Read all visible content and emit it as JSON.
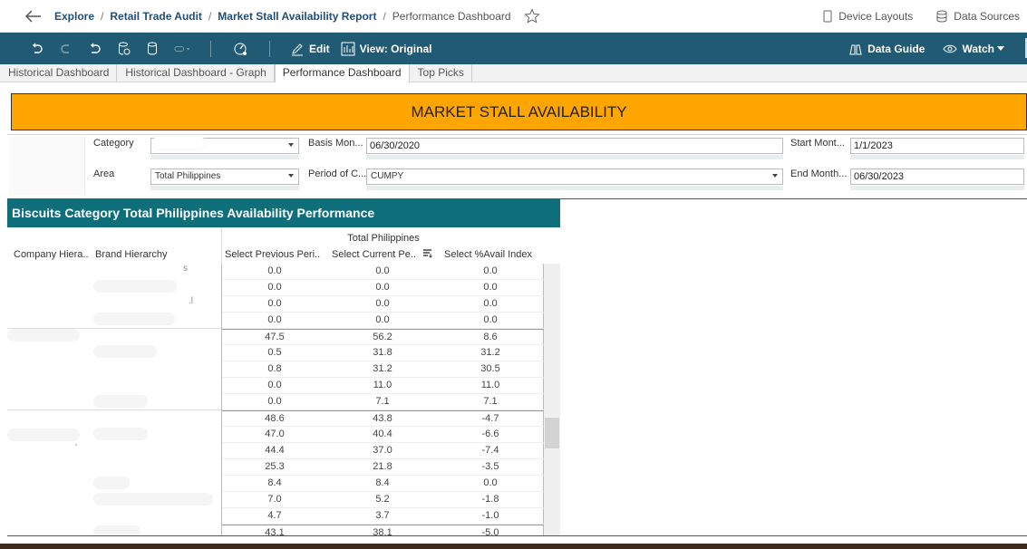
{
  "breadcrumb": {
    "items": [
      "Explore",
      "Retail Trade Audit",
      "Market Stall Availability Report"
    ],
    "current": "Performance Dashboard",
    "separator": "/"
  },
  "top_right": {
    "device_layouts": "Device Layouts",
    "data_sources": "Data Sources"
  },
  "toolbar": {
    "edit_label": "Edit",
    "view_label": "View: Original",
    "data_guide_label": "Data Guide",
    "watch_label": "Watch",
    "accent_color": "#205b73"
  },
  "tabs": [
    {
      "label": "Historical Dashboard",
      "active": false
    },
    {
      "label": "Historical Dashboard - Graph",
      "active": false
    },
    {
      "label": "Performance Dashboard",
      "active": true
    },
    {
      "label": "Top Picks",
      "active": false
    }
  ],
  "dashboard": {
    "title": "MARKET STALL AVAILABILITY",
    "banner_color": "#ffa500",
    "filters": {
      "category_label": "Category",
      "category_value": "",
      "area_label": "Area",
      "area_value": "Total Philippines",
      "basis_month_label": "Basis Mon...",
      "basis_month_value": "06/30/2020",
      "period_label": "Period of C...",
      "period_value": "CUMPY",
      "start_month_label": "Start Mont...",
      "start_month_value": "1/1/2023",
      "end_month_label": "End Month...",
      "end_month_value": "06/30/2023"
    },
    "table": {
      "title": "Biscuits Category  Total Philippines Availability  Performance",
      "title_color": "#0e6e79",
      "group_header": "Total Philippines",
      "row_headers": [
        "Company Hiera..",
        "Brand Hierarchy"
      ],
      "columns": [
        "Select Previous Peri..",
        "Select Current Pe..",
        "Select %Avail Index"
      ],
      "rows": [
        {
          "prev": "0.0",
          "curr": "0.0",
          "idx": "0.0",
          "group_start": false
        },
        {
          "prev": "0.0",
          "curr": "0.0",
          "idx": "0.0",
          "group_start": false
        },
        {
          "prev": "0.0",
          "curr": "0.0",
          "idx": "0.0",
          "group_start": false
        },
        {
          "prev": "0.0",
          "curr": "0.0",
          "idx": "0.0",
          "group_start": false
        },
        {
          "prev": "47.5",
          "curr": "56.2",
          "idx": "8.6",
          "group_start": true
        },
        {
          "prev": "0.5",
          "curr": "31.8",
          "idx": "31.2",
          "group_start": false
        },
        {
          "prev": "0.8",
          "curr": "31.2",
          "idx": "30.5",
          "group_start": false
        },
        {
          "prev": "0.0",
          "curr": "11.0",
          "idx": "11.0",
          "group_start": false
        },
        {
          "prev": "0.0",
          "curr": "7.1",
          "idx": "7.1",
          "group_start": false
        },
        {
          "prev": "48.6",
          "curr": "43.8",
          "idx": "-4.7",
          "group_start": true
        },
        {
          "prev": "47.0",
          "curr": "40.4",
          "idx": "-6.6",
          "group_start": false
        },
        {
          "prev": "44.4",
          "curr": "37.0",
          "idx": "-7.4",
          "group_start": false
        },
        {
          "prev": "25.3",
          "curr": "21.8",
          "idx": "-3.5",
          "group_start": false
        },
        {
          "prev": "8.4",
          "curr": "8.4",
          "idx": "0.0",
          "group_start": false
        },
        {
          "prev": "7.0",
          "curr": "5.2",
          "idx": "-1.8",
          "group_start": false
        },
        {
          "prev": "4.7",
          "curr": "3.7",
          "idx": "-1.0",
          "group_start": false
        },
        {
          "prev": "43.1",
          "curr": "38.1",
          "idx": "-5.0",
          "group_start": true
        }
      ],
      "row_label_fragments": [
        "s",
        ".l",
        "'"
      ]
    }
  }
}
